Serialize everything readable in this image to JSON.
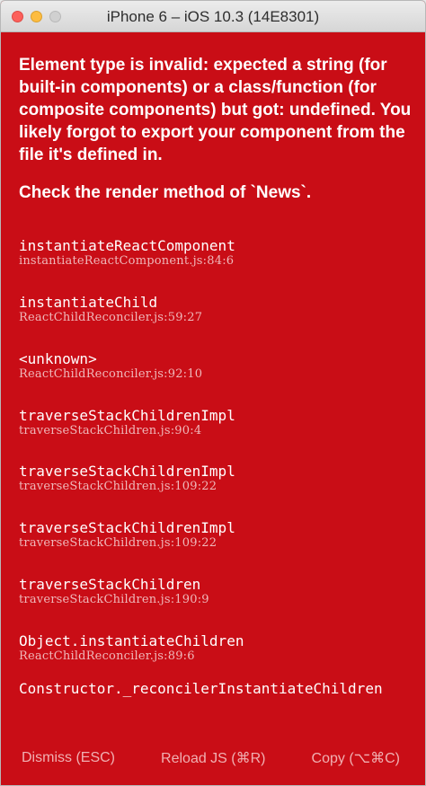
{
  "window": {
    "title": "iPhone 6 – iOS 10.3 (14E8301)"
  },
  "error": {
    "message": "Element type is invalid: expected a string (for built-in components) or a class/function (for composite components) but got: undefined. You likely forgot to export your component from the file it's defined in.",
    "hint": "Check the render method of `News`."
  },
  "stack": [
    {
      "method": "instantiateReactComponent",
      "file": "instantiateReactComponent.js:84:6"
    },
    {
      "method": "instantiateChild",
      "file": "ReactChildReconciler.js:59:27"
    },
    {
      "method": "<unknown>",
      "file": "ReactChildReconciler.js:92:10"
    },
    {
      "method": "traverseStackChildrenImpl",
      "file": "traverseStackChildren.js:90:4"
    },
    {
      "method": "traverseStackChildrenImpl",
      "file": "traverseStackChildren.js:109:22"
    },
    {
      "method": "traverseStackChildrenImpl",
      "file": "traverseStackChildren.js:109:22"
    },
    {
      "method": "traverseStackChildren",
      "file": "traverseStackChildren.js:190:9"
    },
    {
      "method": "Object.instantiateChildren",
      "file": "ReactChildReconciler.js:89:6"
    },
    {
      "method": "Constructor._reconcilerInstantiateChildren",
      "file": ""
    }
  ],
  "footer": {
    "dismiss_label": "Dismiss (ESC)",
    "reload_label": "Reload JS (⌘R)",
    "copy_label": "Copy (⌥⌘C)"
  },
  "colors": {
    "background": "#c90d16",
    "text": "#ffffff",
    "secondary_text": "#efb8ba",
    "footer_text": "#f0b0b2"
  },
  "icons": [
    "close-icon",
    "minimize-icon",
    "zoom-icon"
  ]
}
